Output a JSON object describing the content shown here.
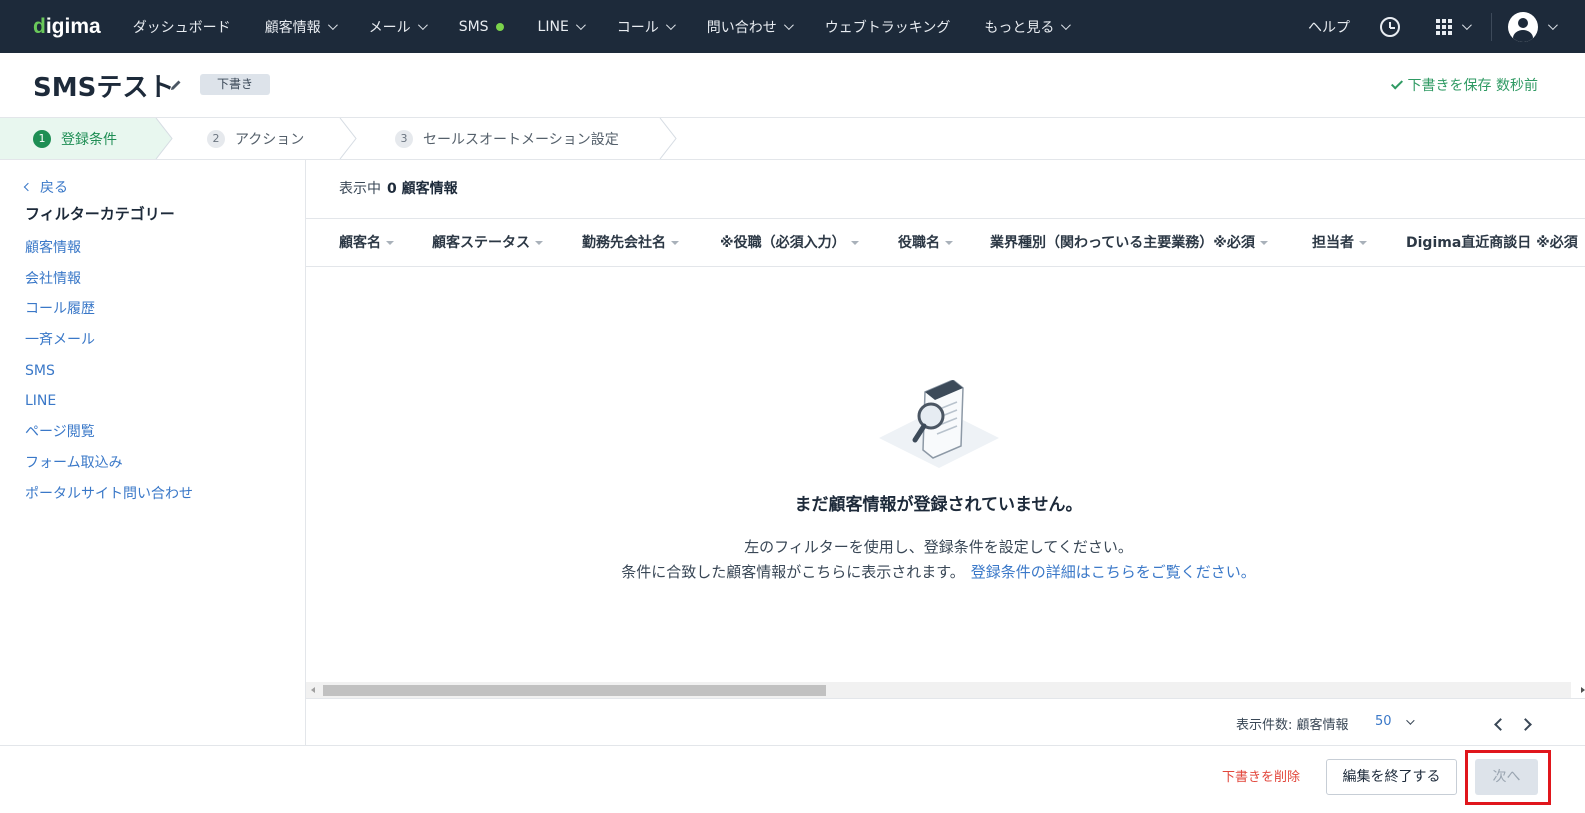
{
  "nav": {
    "logo": "digima",
    "items": [
      {
        "label": "ダッシュボード",
        "chevron": false
      },
      {
        "label": "顧客情報",
        "chevron": true
      },
      {
        "label": "メール",
        "chevron": true
      },
      {
        "label": "SMS",
        "chevron": false,
        "dot": true
      },
      {
        "label": "LINE",
        "chevron": true
      },
      {
        "label": "コール",
        "chevron": true
      },
      {
        "label": "問い合わせ",
        "chevron": true
      },
      {
        "label": "ウェブトラッキング",
        "chevron": false
      },
      {
        "label": "もっと見る",
        "chevron": true
      }
    ],
    "help": "ヘルプ",
    "icons": [
      "alarm-icon",
      "apps-grid-icon",
      "user-avatar-icon"
    ]
  },
  "header": {
    "title": "SMSテスト",
    "badge": "下書き",
    "save_status": "下書きを保存 数秒前"
  },
  "stepper": {
    "steps": [
      {
        "num": "1",
        "label": "登録条件",
        "active": true
      },
      {
        "num": "2",
        "label": "アクション",
        "active": false
      },
      {
        "num": "3",
        "label": "セールスオートメーション設定",
        "active": false
      }
    ]
  },
  "sidebar": {
    "back": "戻る",
    "title": "フィルターカテゴリー",
    "items": [
      "顧客情報",
      "会社情報",
      "コール履歴",
      "一斉メール",
      "SMS",
      "LINE",
      "ページ閲覧",
      "フォーム取込み",
      "ポータルサイト問い合わせ"
    ]
  },
  "main": {
    "display_prefix": "表示中",
    "display_count": "0 顧客情報",
    "columns": [
      "顧客名",
      "顧客ステータス",
      "勤務先会社名",
      "※役職（必須入力）",
      "役職名",
      "業界種別（関わっている主要業務）※必須",
      "担当者",
      "Digima直近商談日 ※必須"
    ],
    "empty_title": "まだ顧客情報が登録されていません。",
    "empty_line1": "左のフィルターを使用し、登録条件を設定してください。",
    "empty_line2": "条件に合致した顧客情報がこちらに表示されます。",
    "empty_link": "登録条件の詳細はこちらをご覧ください。",
    "pager_label": "表示件数: 顧客情報",
    "pager_size": "50"
  },
  "footer": {
    "delete_draft": "下書きを削除",
    "end_edit": "編集を終了する",
    "next": "次へ"
  },
  "colors": {
    "nav_bg": "#1d2a3a",
    "accent_green": "#1e8e54",
    "link_blue": "#3a78c8",
    "danger_red": "#e2473c",
    "highlight_red": "#e0161c"
  }
}
